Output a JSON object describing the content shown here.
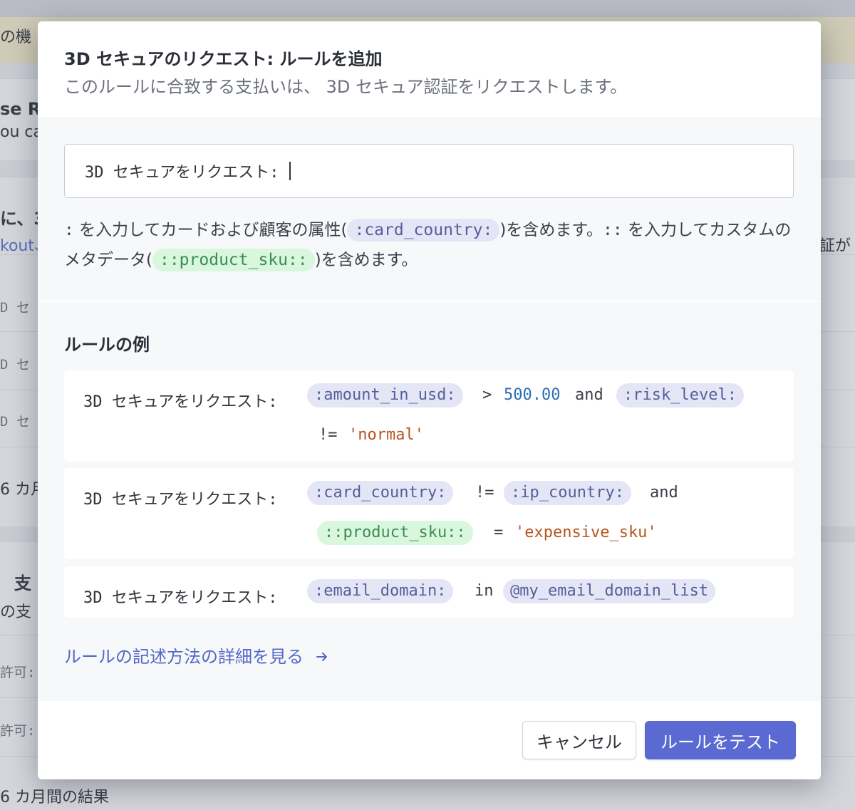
{
  "background": {
    "banner_text": "の機",
    "card1_line1": "se Ra",
    "card1_line2": "ou ca",
    "card2_title": "に、3",
    "card2_link": "kout、",
    "card2_right": "証が",
    "row_texts": [
      "D セ",
      "D セ",
      "D セ"
    ],
    "months_text": "6 カ月",
    "card3_title": "支",
    "card3_sub": "の支",
    "allow_rows": [
      "許可:",
      "許可:"
    ],
    "bottom_text": "6 カ月間の結果"
  },
  "modal": {
    "title": "3D セキュアのリクエスト: ルールを追加",
    "subtitle": "このルールに合致する支払いは、 3D セキュア認証をリクエストします。",
    "input": {
      "prefix": "3D セキュアをリクエスト:",
      "value": ""
    },
    "help": {
      "part1_code": ":",
      "part1_text": " を入力してカードおよび顧客の属性(",
      "chip1": ":card_country:",
      "part2_text": ")を含めます。",
      "part2_code": "::",
      "part3_text": " を入力してカスタムのメタデータ(",
      "chip2": "::product_sku::",
      "part4_text": ")を含めます。"
    },
    "examples_heading": "ルールの例",
    "examples": [
      {
        "prefix": "3D セキュアをリクエスト:",
        "tokens": [
          ":amount_in_usd:",
          ">",
          "500.00",
          "and",
          ":risk_level:",
          "!=",
          "'normal'"
        ]
      },
      {
        "prefix": "3D セキュアをリクエスト:",
        "tokens": [
          ":card_country:",
          "!=",
          ":ip_country:",
          "and",
          "::product_sku::",
          "=",
          "'expensive_sku'"
        ]
      },
      {
        "prefix": "3D セキュアをリクエスト:",
        "tokens": [
          ":email_domain:",
          "in",
          "@my_email_domain_list"
        ]
      }
    ],
    "details_link": "ルールの記述方法の詳細を見る",
    "arrow_icon": "arrow-right-icon",
    "cancel_label": "キャンセル",
    "test_label": "ルールをテスト"
  },
  "colors": {
    "accent": "#5b6ad2",
    "link": "#5468c5",
    "chip_purple": "#e5e6f5",
    "chip_green": "#d9f7dd",
    "number": "#2a6db3",
    "string": "#b5561f"
  }
}
